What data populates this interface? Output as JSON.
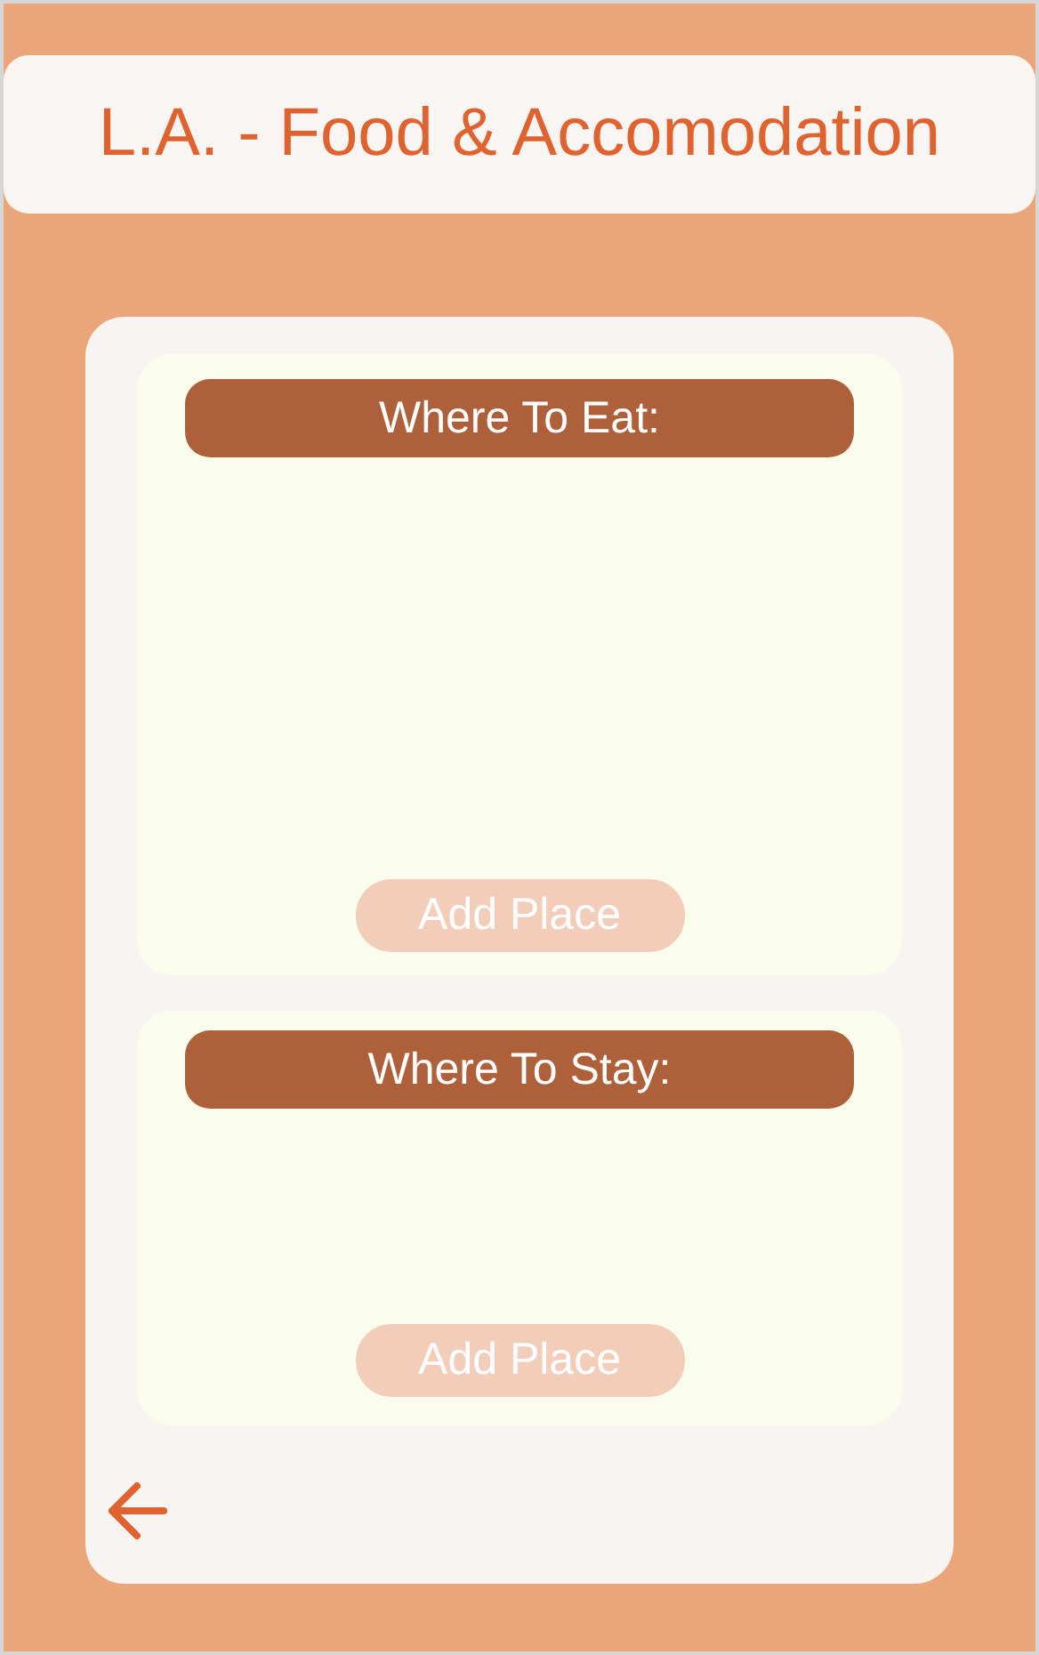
{
  "title": "L.A. - Food & Accomodation",
  "sections": [
    {
      "heading": "Where To Eat:",
      "button": "Add Place"
    },
    {
      "heading": "Where To Stay:",
      "button": "Add Place"
    }
  ]
}
